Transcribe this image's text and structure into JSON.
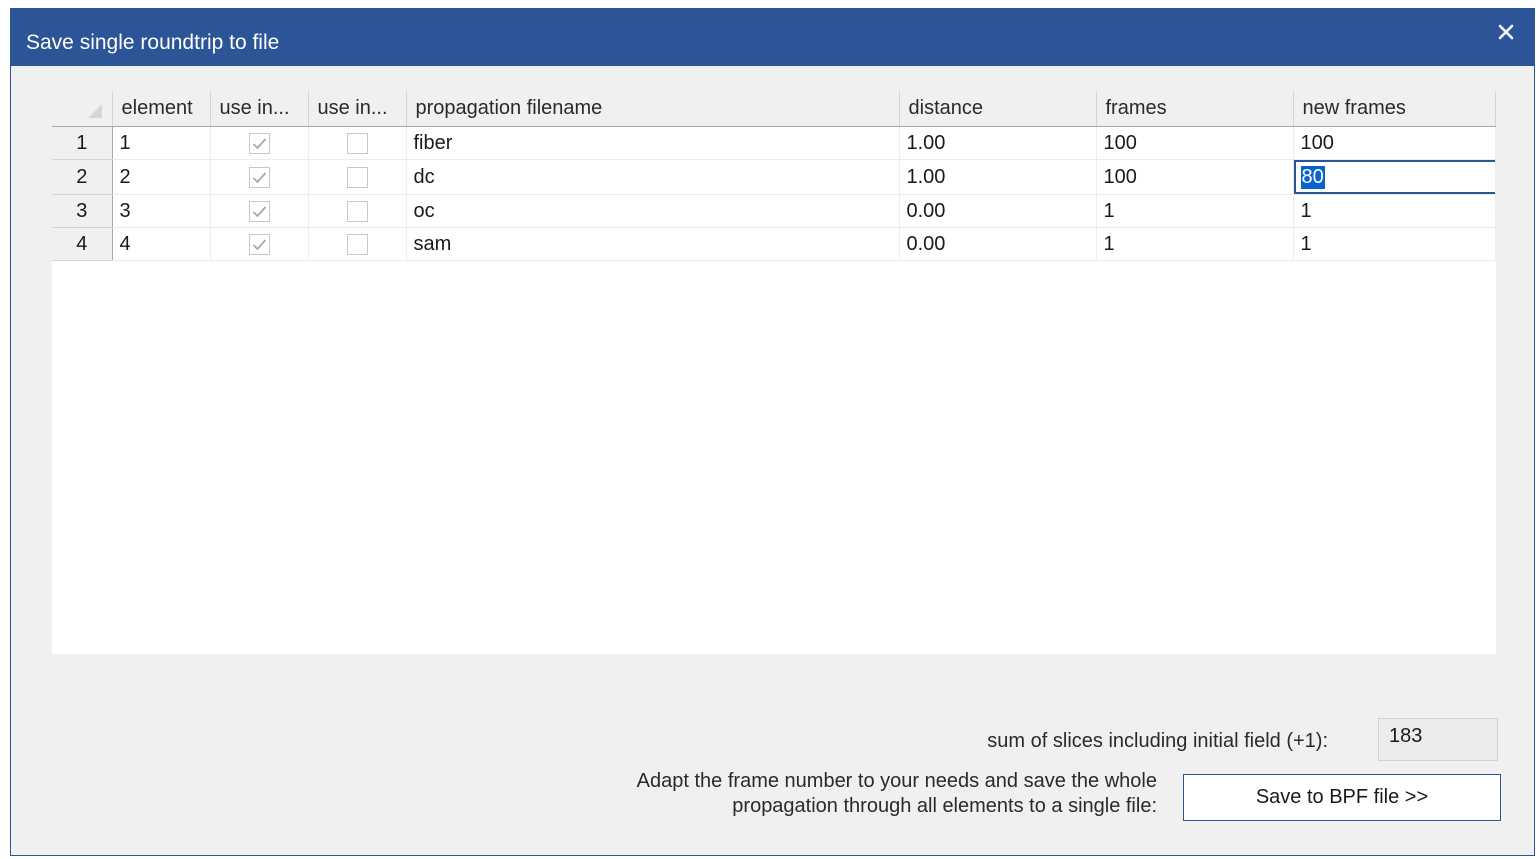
{
  "dialog": {
    "title": "Save single roundtrip to file",
    "close_glyph": "close-icon"
  },
  "table": {
    "columns": [
      "element",
      "use in...",
      "use in...",
      "propagation filename",
      "distance",
      "frames",
      "new frames"
    ],
    "rows": [
      {
        "row_num": "1",
        "element": "1",
        "use_in_1": true,
        "use_in_2": false,
        "filename": "fiber",
        "distance": "1.00",
        "frames": "100",
        "new_frames": "100"
      },
      {
        "row_num": "2",
        "element": "2",
        "use_in_1": true,
        "use_in_2": false,
        "filename": "dc",
        "distance": "1.00",
        "frames": "100",
        "new_frames": "80"
      },
      {
        "row_num": "3",
        "element": "3",
        "use_in_1": true,
        "use_in_2": false,
        "filename": "oc",
        "distance": "0.00",
        "frames": "1",
        "new_frames": "1"
      },
      {
        "row_num": "4",
        "element": "4",
        "use_in_1": true,
        "use_in_2": false,
        "filename": "sam",
        "distance": "0.00",
        "frames": "1",
        "new_frames": "1"
      }
    ],
    "editing_cell": {
      "row": 2,
      "column": "new frames"
    }
  },
  "footer": {
    "sum_label": "sum of slices including initial field (+1):",
    "sum_value": "183",
    "adapt_line1": "Adapt the frame number to your needs and save the whole",
    "adapt_line2": "propagation through all elements to a single file:",
    "save_button": "Save to BPF file >>"
  },
  "colors": {
    "title_bar": "#2c5597",
    "dialog_bg": "#f0f0f0",
    "selection": "#0a64d0"
  }
}
